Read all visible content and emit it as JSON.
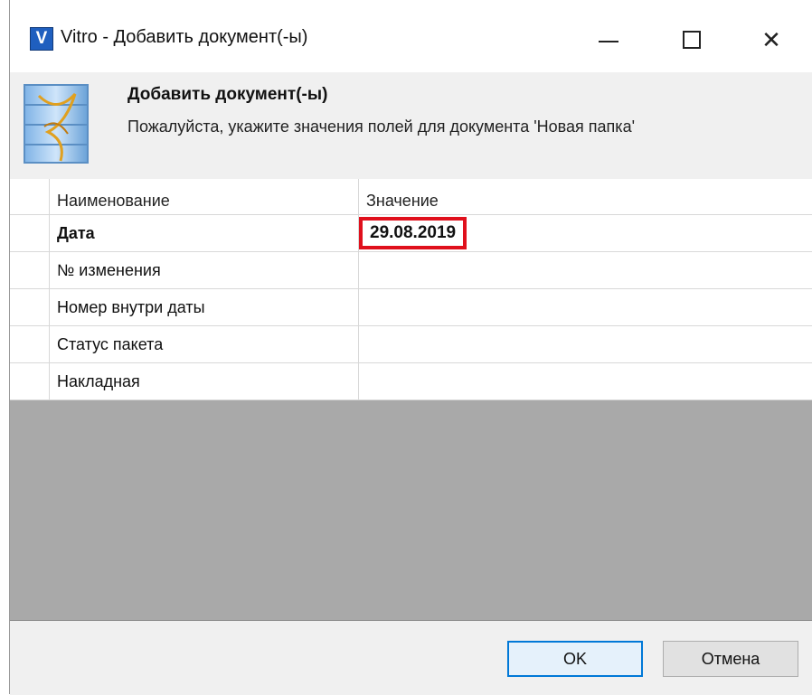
{
  "window": {
    "title": "Vitro - Добавить документ(-ы)",
    "app_icon_letter": "V"
  },
  "header": {
    "title": "Добавить документ(-ы)",
    "subtitle": "Пожалуйста, укажите значения полей для документа 'Новая папка'"
  },
  "grid": {
    "columns": [
      "Наименование",
      "Значение"
    ],
    "rows": [
      {
        "name": "Дата",
        "value": "29.08.2019"
      },
      {
        "name": "№ изменения",
        "value": ""
      },
      {
        "name": "Номер внутри даты",
        "value": ""
      },
      {
        "name": "Статус пакета",
        "value": ""
      },
      {
        "name": "Накладная",
        "value": ""
      }
    ]
  },
  "footer": {
    "ok_label": "OK",
    "cancel_label": "Отмена"
  },
  "colors": {
    "highlight": "#e0101c",
    "accent": "#0078d7"
  }
}
